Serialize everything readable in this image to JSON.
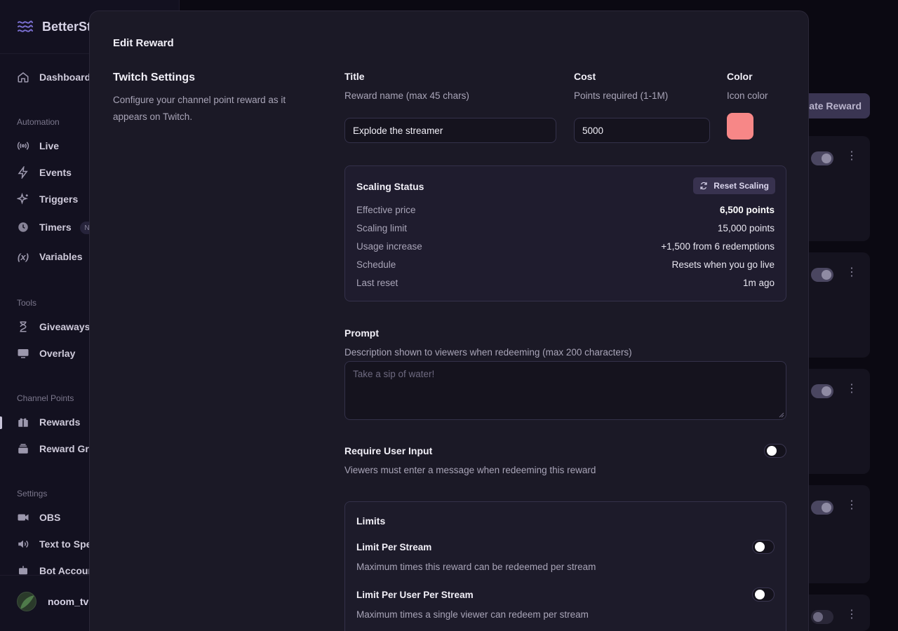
{
  "sidebar": {
    "brand": "BetterSt",
    "items": {
      "dashboard": "Dashboard",
      "live": "Live",
      "events": "Events",
      "triggers": "Triggers",
      "timers": "Timers",
      "variables": "Variables",
      "giveaways": "Giveaways",
      "overlay": "Overlay",
      "rewards": "Rewards",
      "reward_groups": "Reward Gro",
      "obs": "OBS",
      "tts": "Text to Spe",
      "bot_account": "Bot Accoun"
    },
    "sections": {
      "automation": "Automation",
      "tools": "Tools",
      "channel_points": "Channel Points",
      "settings": "Settings"
    },
    "timers_badge": "N",
    "user": {
      "name": "noom_tv",
      "avatar_alt": "noo"
    }
  },
  "background": {
    "create_button": "eate Reward"
  },
  "modal": {
    "title": "Edit Reward",
    "section_title": "Twitch Settings",
    "section_desc": "Configure your channel point reward as it appears on Twitch.",
    "title_field": {
      "label": "Title",
      "hint": "Reward name (max 45 chars)",
      "value": "Explode the streamer"
    },
    "cost_field": {
      "label": "Cost",
      "hint": "Points required (1-1M)",
      "value": "5000"
    },
    "color_field": {
      "label": "Color",
      "hint": "Icon color",
      "value": "#f78787"
    },
    "scaling": {
      "title": "Scaling Status",
      "reset_label": "Reset Scaling",
      "rows": [
        {
          "key": "Effective price",
          "value": "6,500 points"
        },
        {
          "key": "Scaling limit",
          "value": "15,000 points"
        },
        {
          "key": "Usage increase",
          "value": "+1,500 from 6 redemptions"
        },
        {
          "key": "Schedule",
          "value": "Resets when you go live"
        },
        {
          "key": "Last reset",
          "value": "1m ago"
        }
      ]
    },
    "prompt": {
      "label": "Prompt",
      "hint": "Description shown to viewers when redeeming (max 200 characters)",
      "placeholder": "Take a sip of water!"
    },
    "require_input": {
      "label": "Require User Input",
      "hint": "Viewers must enter a message when redeeming this reward",
      "enabled": false
    },
    "limits": {
      "title": "Limits",
      "per_stream": {
        "label": "Limit Per Stream",
        "hint": "Maximum times this reward can be redeemed per stream",
        "enabled": false
      },
      "per_user": {
        "label": "Limit Per User Per Stream",
        "hint": "Maximum times a single viewer can redeem per stream",
        "enabled": false
      }
    }
  }
}
